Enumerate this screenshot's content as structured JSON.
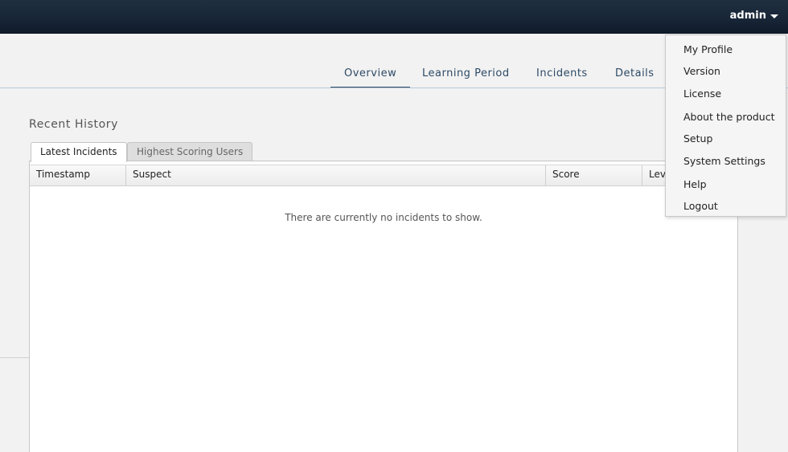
{
  "header": {
    "user_label": "admin"
  },
  "nav": {
    "tabs": [
      "Overview",
      "Learning Period",
      "Incidents",
      "Details"
    ],
    "active_tab": "Overview"
  },
  "recent_history": {
    "title": "Recent History",
    "subtabs": [
      "Latest Incidents",
      "Highest Scoring Users"
    ],
    "active_subtab": "Latest Incidents",
    "columns": [
      "Timestamp",
      "Suspect",
      "Score",
      "Lev"
    ],
    "empty_message": "There are currently no incidents to show."
  },
  "user_dropdown": {
    "items": [
      "My Profile",
      "Version",
      "License",
      "About the product",
      "Setup",
      "System Settings",
      "Help",
      "Logout"
    ]
  },
  "colors": {
    "topbar": "#182638",
    "nav_text": "#2d4a66",
    "background": "#f2f2f2"
  }
}
